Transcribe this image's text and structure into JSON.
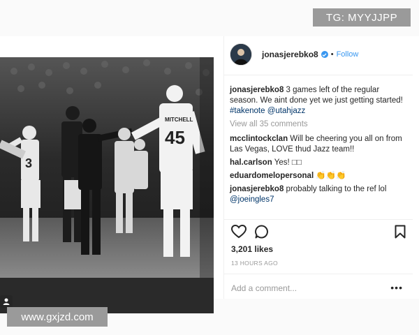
{
  "watermark_top": "TG: MYYJJPP",
  "watermark_bottom": "www.gxjzd.com",
  "post": {
    "username": "jonasjerebko8",
    "separator": "•",
    "follow_label": "Follow",
    "photo_jersey_name": "MITCHELL",
    "photo_jersey_number": "45",
    "photo_jersey_number_left": "3",
    "caption": {
      "user": "jonasjerebko8",
      "text": "3 games left of the regular season. We aint done yet we just getting started!",
      "hashtag": "#takenote",
      "mention": "@utahjazz"
    },
    "view_all": "View all 35 comments",
    "comments": [
      {
        "user": "mcclintockclan",
        "text": "Will be cheering you all on from Las Vegas, LOVE thud Jazz team!!"
      },
      {
        "user": "hal.carlson",
        "text": "Yes! □□"
      },
      {
        "user": "eduardomelopersonal",
        "text": "👏👏👏"
      },
      {
        "user": "jonasjerebko8",
        "text": "probably talking to the ref lol",
        "mention": "@joeingles7"
      }
    ],
    "likes": "3,201 likes",
    "time_ago": "13 HOURS AGO",
    "add_comment_placeholder": "Add a comment...",
    "more_label": "•••"
  },
  "icons": {
    "like": "heart-icon",
    "comment": "comment-icon",
    "save": "bookmark-icon",
    "verified": "verified-badge-icon",
    "tag": "person-tag-icon"
  },
  "colors": {
    "link_blue": "#3897f0",
    "hashtag": "#003569",
    "muted": "#999999"
  }
}
